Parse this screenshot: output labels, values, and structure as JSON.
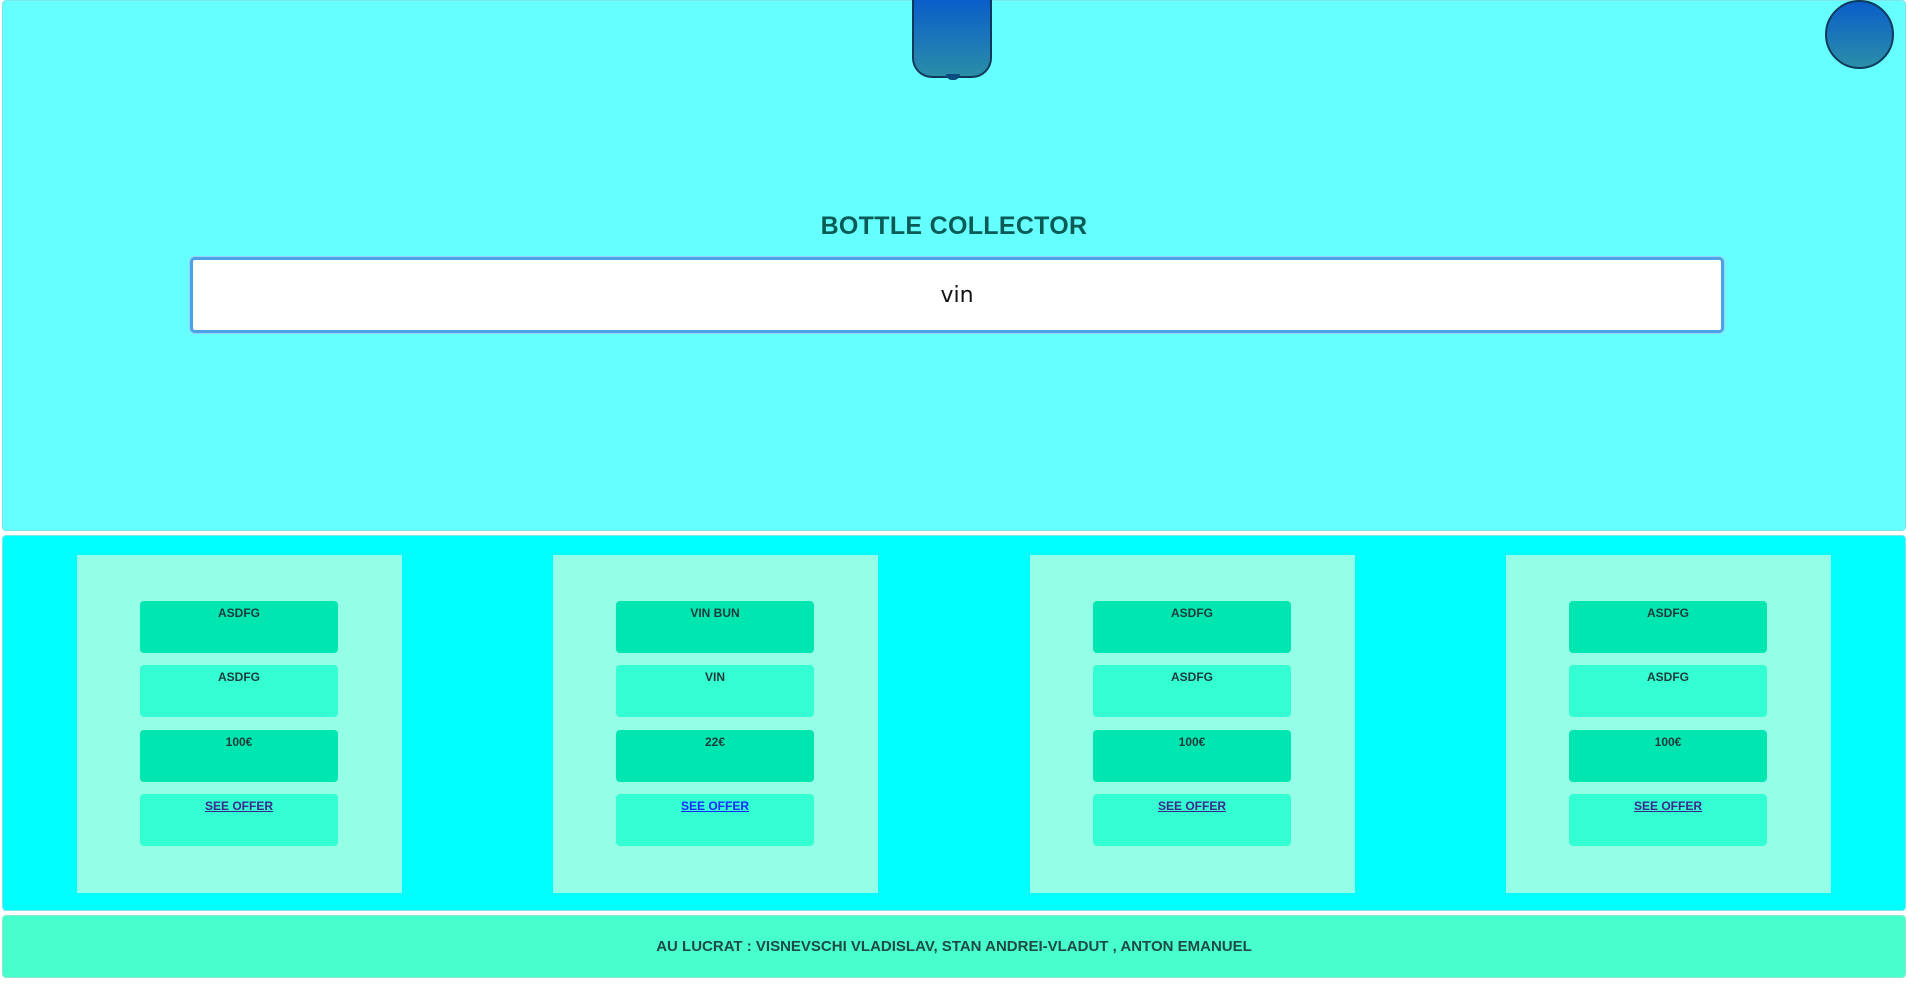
{
  "header": {
    "title": "BOTTLE COLLECTOR",
    "search_value": "vin",
    "left_avatar_icon": "user-avatar",
    "right_avatar_icon": "user-avatar",
    "background_color": "#66ffff"
  },
  "results": {
    "background_color": "#00ffff",
    "cards": [
      {
        "name": "ASDFG",
        "type": "ASDFG",
        "price": "100€",
        "link_label": "SEE OFFER"
      },
      {
        "name": "VIN BUN",
        "type": "VIN",
        "price": "22€",
        "link_label": "SEE OFFER"
      },
      {
        "name": "ASDFG",
        "type": "ASDFG",
        "price": "100€",
        "link_label": "SEE OFFER"
      },
      {
        "name": "ASDFG",
        "type": "ASDFG",
        "price": "100€",
        "link_label": "SEE OFFER"
      }
    ]
  },
  "footer": {
    "text": "AU LUCRAT : VISNEVSCHI VLADISLAV, STAN ANDREI-VLADUT , ANTON EMANUEL"
  }
}
